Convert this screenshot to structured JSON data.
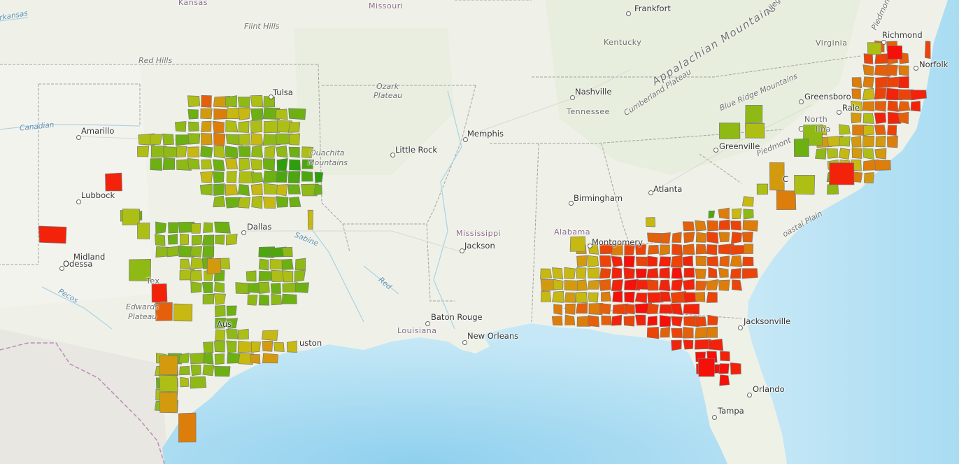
{
  "colors": {
    "land": "#eef0e6",
    "water": "#bfe4f5",
    "water_deep": "#9fd6f0",
    "county_border": "#888888",
    "state_border": "#9a9a9a",
    "scale": [
      "#2f9e0c",
      "#4ea60e",
      "#6cb012",
      "#8fb915",
      "#adbf15",
      "#c7b812",
      "#d49a0e",
      "#dd7d0a",
      "#e5600a",
      "#ec4308",
      "#f2230a",
      "#f5100a"
    ]
  },
  "labels": {
    "cities": {
      "richmond": "Richmond",
      "frankfort": "Frankfort",
      "norfolk": "Norfolk",
      "tulsa": "Tulsa",
      "nashville": "Nashville",
      "greensboro": "Greensboro",
      "raleigh": "Rale",
      "amarillo": "Amarillo",
      "memphis": "Memphis",
      "little_rock": "Little Rock",
      "greenville": "Greenville",
      "charlotte": "C",
      "lubbock": "Lubbock",
      "birmingham": "Birmingham",
      "atlanta": "Atlanta",
      "dallas": "Dallas",
      "montgomery": "Montgomery",
      "midland": "Midland",
      "odessa": "Odessa",
      "jackson": "Jackson",
      "baton_rouge": "Baton Rouge",
      "jacksonville": "Jacksonville",
      "new_orleans": "New Orleans",
      "austin": "Aus",
      "houston": "uston",
      "orlando": "Orlando",
      "tampa": "Tampa"
    },
    "states": {
      "kansas": "Kansas",
      "missouri": "Missouri",
      "kentucky": "Kentucky",
      "virginia": "Virginia",
      "tennessee": "Tennessee",
      "north_carolina_1": "North",
      "north_carolina_2": "C",
      "north_carolina_3": "lina",
      "mississippi": "Mississippi",
      "alabama": "Alabama",
      "texas": "Tex",
      "louisiana": "Louisiana"
    },
    "physical": {
      "flint_hills": "Flint Hills",
      "red_hills": "Red Hills",
      "ozark_1": "Ozark",
      "ozark_2": "Plateau",
      "ouachita_1": "Ouachita",
      "ouachita_2": "Mountains",
      "appalachian": "Appalachian Mountains",
      "cumberland": "Cumberland Plateau",
      "blue_ridge": "Blue Ridge Mountains",
      "piedmont_ne": "Piedmont",
      "piedmont_nc": "Piedmont",
      "allegheny": "Alleg",
      "coastal_plain": "oastal Plain",
      "edwards_1": "Edwards",
      "edwards_2": "Plateau"
    },
    "water": {
      "canadian_ne": "Arkansas",
      "canadian": "Canadian",
      "sabine": "Sabine",
      "red": "Red",
      "pecos": "Pecos"
    }
  }
}
